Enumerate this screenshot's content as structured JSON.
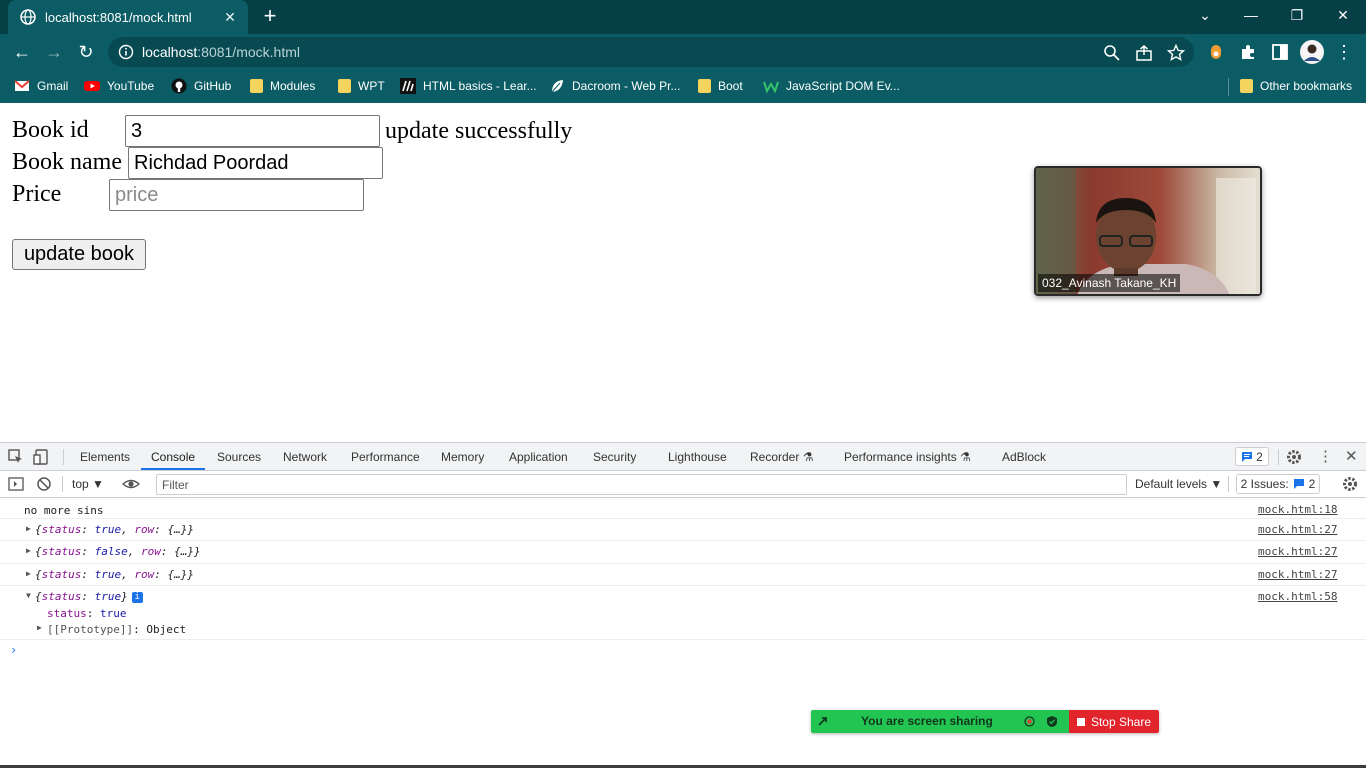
{
  "browser": {
    "tab_title": "localhost:8081/mock.html",
    "tab_close": "✕",
    "new_tab": "+",
    "url_host": "localhost",
    "url_rest": ":8081/mock.html",
    "bookmarks": [
      {
        "label": "Gmail",
        "icon": "gmail-icon"
      },
      {
        "label": "YouTube",
        "icon": "youtube-icon"
      },
      {
        "label": "GitHub",
        "icon": "github-icon"
      },
      {
        "label": "Modules",
        "icon": "folder-icon"
      },
      {
        "label": "WPT",
        "icon": "folder-icon"
      },
      {
        "label": "HTML basics - Lear...",
        "icon": "mdn-icon"
      },
      {
        "label": "Dacroom - Web Pr...",
        "icon": "leaf-icon"
      },
      {
        "label": "Boot",
        "icon": "folder-icon"
      },
      {
        "label": "JavaScript DOM Ev...",
        "icon": "w-icon"
      }
    ],
    "other_bookmarks": "Other bookmarks"
  },
  "page": {
    "book_id_label": "Book id",
    "book_id_value": "3",
    "book_name_label": "Book name",
    "book_name_value": "Richdad Poordad",
    "price_label": "Price",
    "price_placeholder": "price",
    "message": "update successfully",
    "update_button": "update book"
  },
  "video": {
    "participant": "032_Avinash Takane_KH"
  },
  "devtools": {
    "tabs": [
      "Elements",
      "Console",
      "Sources",
      "Network",
      "Performance",
      "Memory",
      "Application",
      "Security",
      "Lighthouse",
      "Recorder",
      "Performance insights",
      "AdBlock"
    ],
    "active_tab": "Console",
    "message_count": "2",
    "context": "top ▼",
    "filter_placeholder": "Filter",
    "levels": "Default levels ▼",
    "issues_label": "2 Issues:",
    "issues_count": "2",
    "logs": [
      {
        "text": "no more sins",
        "source": "mock.html:18"
      },
      {
        "open": "{",
        "k1": "status",
        "v1": "true",
        "k2": "row",
        "v2": "{…}",
        "close": "}",
        "source": "mock.html:27"
      },
      {
        "open": "{",
        "k1": "status",
        "v1": "false",
        "k2": "row",
        "v2": "{…}",
        "close": "}",
        "source": "mock.html:27"
      },
      {
        "open": "{",
        "k1": "status",
        "v1": "true",
        "k2": "row",
        "v2": "{…}",
        "close": "}",
        "source": "mock.html:27"
      },
      {
        "open": "{",
        "k1": "status",
        "v1": "true",
        "close": "}",
        "source": "mock.html:58",
        "expanded": {
          "status_key": "status",
          "status_value": "true",
          "proto_key": "[[Prototype]]",
          "proto_value": "Object"
        }
      }
    ]
  },
  "share_bar": {
    "message": "You are screen sharing",
    "stop": "Stop Share"
  },
  "colors": {
    "chrome_frame": "#063f46",
    "chrome_toolbar": "#0b5c64",
    "share_green": "#23c552",
    "share_red": "#e2252d",
    "devtools_accent": "#1a73e8"
  }
}
